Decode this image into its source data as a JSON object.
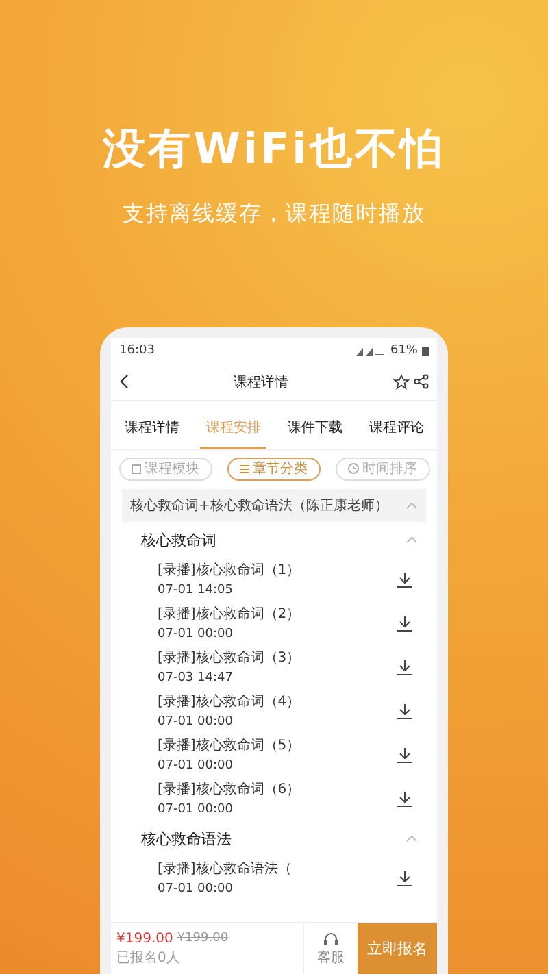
{
  "hero": {
    "title": "没有WiFi也不怕",
    "subtitle": "支持离线缓存，课程随时播放"
  },
  "status_bar": {
    "time": "16:03",
    "battery": "61%"
  },
  "header": {
    "title": "课程详情"
  },
  "tabs": [
    {
      "label": "课程详情",
      "selected": false
    },
    {
      "label": "课程安排",
      "selected": true
    },
    {
      "label": "课件下载",
      "selected": false
    },
    {
      "label": "课程评论",
      "selected": false
    }
  ],
  "filters": [
    {
      "label": "课程模块",
      "selected": false,
      "kind": "module"
    },
    {
      "label": "章节分类",
      "selected": true,
      "kind": "chapter"
    },
    {
      "label": "时间排序",
      "selected": false,
      "kind": "time"
    }
  ],
  "course": {
    "title": "核心救命词+核心救命语法（陈正康老师）",
    "expanded": true,
    "chapters": [
      {
        "title": "核心救命词",
        "expanded": true,
        "lessons": [
          {
            "title": "[录播]核心救命词（1）",
            "date": "07-01 14:05"
          },
          {
            "title": "[录播]核心救命词（2）",
            "date": "07-01 00:00"
          },
          {
            "title": "[录播]核心救命词（3）",
            "date": "07-03 14:47"
          },
          {
            "title": "[录播]核心救命词（4）",
            "date": "07-01 00:00"
          },
          {
            "title": "[录播]核心救命词（5）",
            "date": "07-01 00:00"
          },
          {
            "title": "[录播]核心救命词（6）",
            "date": "07-01 00:00"
          }
        ]
      },
      {
        "title": "核心救命语法",
        "expanded": true,
        "lessons": [
          {
            "title": "[录播]核心救命语法（",
            "date": "07-01 00:00"
          }
        ]
      }
    ]
  },
  "footer": {
    "price": "¥199.00",
    "original_price": "¥199.00",
    "enrolled": "已报名0人",
    "service": "客服",
    "cta": "立即报名"
  }
}
